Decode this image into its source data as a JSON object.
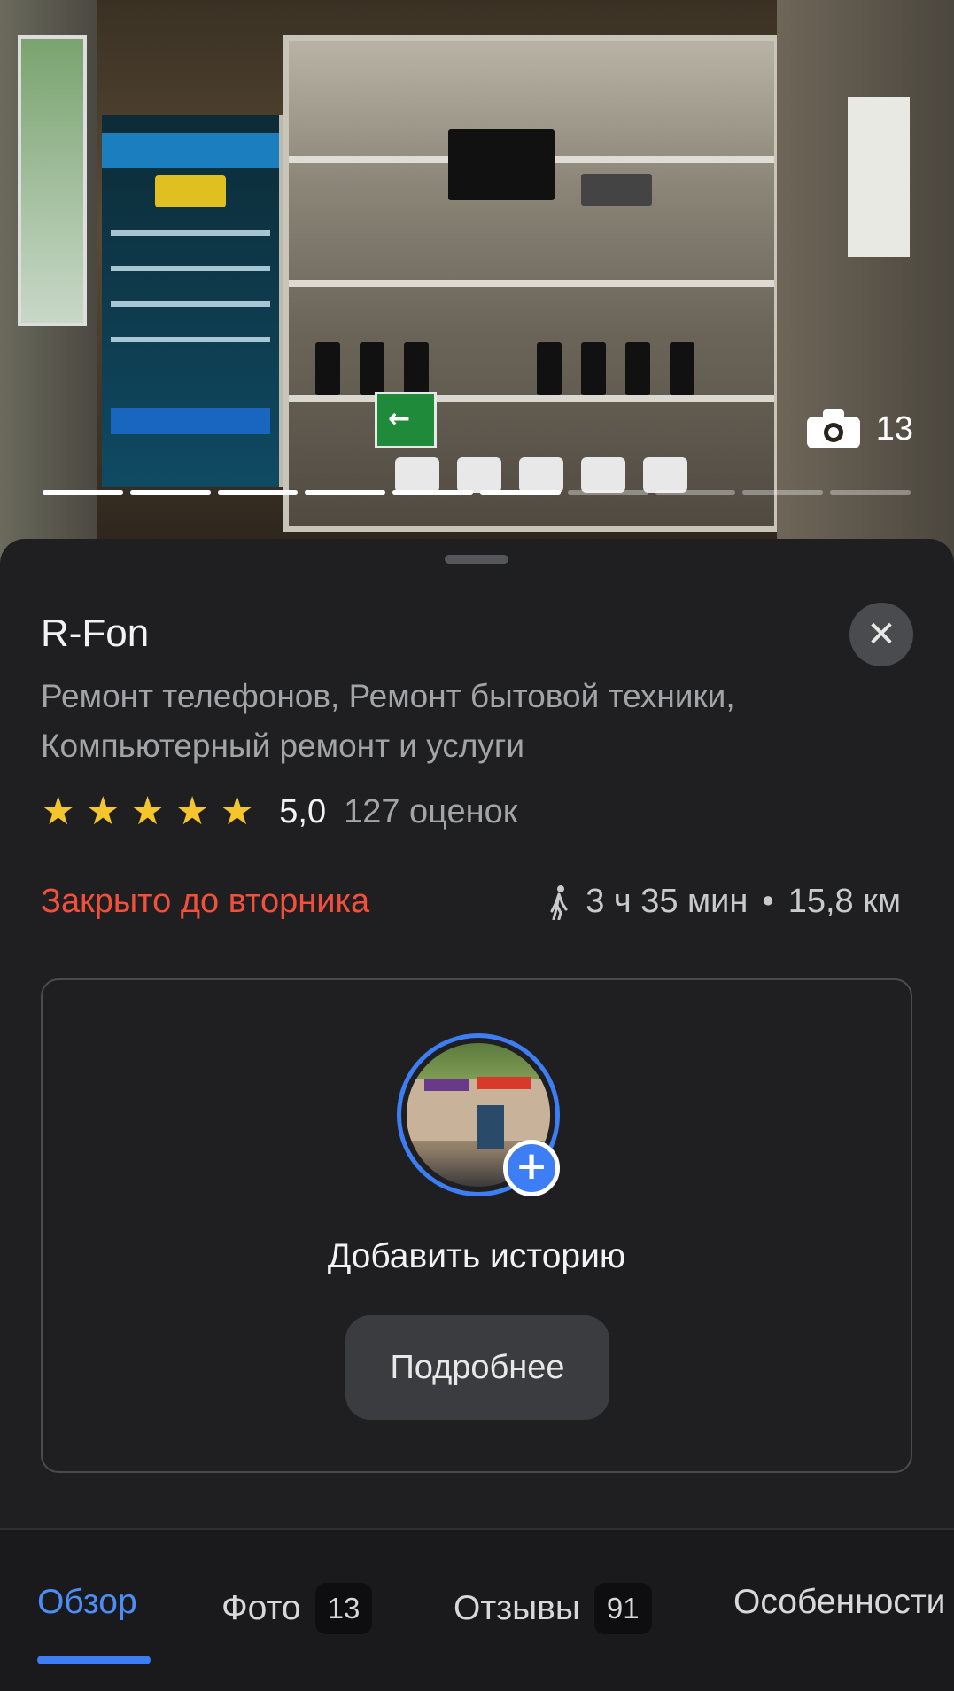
{
  "photo": {
    "photo_count": "13",
    "exit_arrow": "←",
    "progress": {
      "total": 10,
      "current": 6
    }
  },
  "place": {
    "name": "R-Fon",
    "categories": "Ремонт телефонов, Ремонт бытовой техники, Компьютерный ремонт и услуги",
    "rating": "5,0",
    "rating_count": "127 оценок",
    "stars": 5,
    "status": "Закрыто до вторника",
    "route_time": "3 ч 35 мин",
    "route_sep": "•",
    "route_distance": "15,8 км"
  },
  "story": {
    "plus": "+",
    "label": "Добавить историю",
    "more_button": "Подробнее"
  },
  "close_glyph": "✕",
  "tabs": [
    {
      "label": "Обзор",
      "active": true
    },
    {
      "label": "Фото",
      "badge": "13"
    },
    {
      "label": "Отзывы",
      "badge": "91"
    },
    {
      "label": "Особенности"
    }
  ],
  "colors": {
    "accent": "#3d7ef5",
    "status_closed": "#f0503c",
    "star": "#f4c52d",
    "background": "#1f1f21"
  },
  "icons": {
    "camera": "camera-icon",
    "close": "close-icon",
    "walk": "walking-person-icon",
    "plus": "plus-icon",
    "star": "star-icon"
  }
}
